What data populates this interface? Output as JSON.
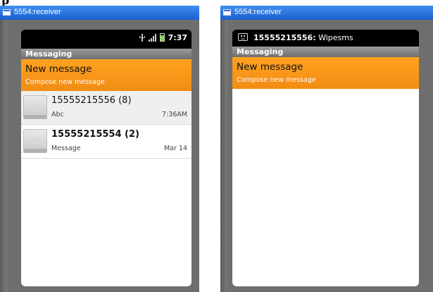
{
  "header_fragment": "p",
  "left": {
    "window_title": "5554:receiver",
    "status_time": "7:37",
    "app_title": "Messaging",
    "new_message": {
      "title": "New message",
      "subtitle": "Compose new message"
    },
    "threads": [
      {
        "name": "15555215556 (8)",
        "snippet": "Abc",
        "date": "7:36AM",
        "bold": false,
        "selected": true
      },
      {
        "name": "15555215554 (2)",
        "snippet": "Message",
        "date": "Mar 14",
        "bold": true,
        "selected": false
      }
    ]
  },
  "right": {
    "window_title": "5554:receiver",
    "notification_sender": "15555215556:",
    "notification_text": " Wipesms",
    "app_title": "Messaging",
    "new_message": {
      "title": "New message",
      "subtitle": "Compose new message"
    }
  },
  "icons": [
    "window-icon",
    "usb-icon",
    "signal-icon",
    "battery-icon",
    "sms-notification-icon",
    "contact-avatar-icon"
  ],
  "colors": {
    "accent": "#f7931e",
    "titlebar": "#2a6ad8",
    "frame": "#6e6e6e"
  }
}
